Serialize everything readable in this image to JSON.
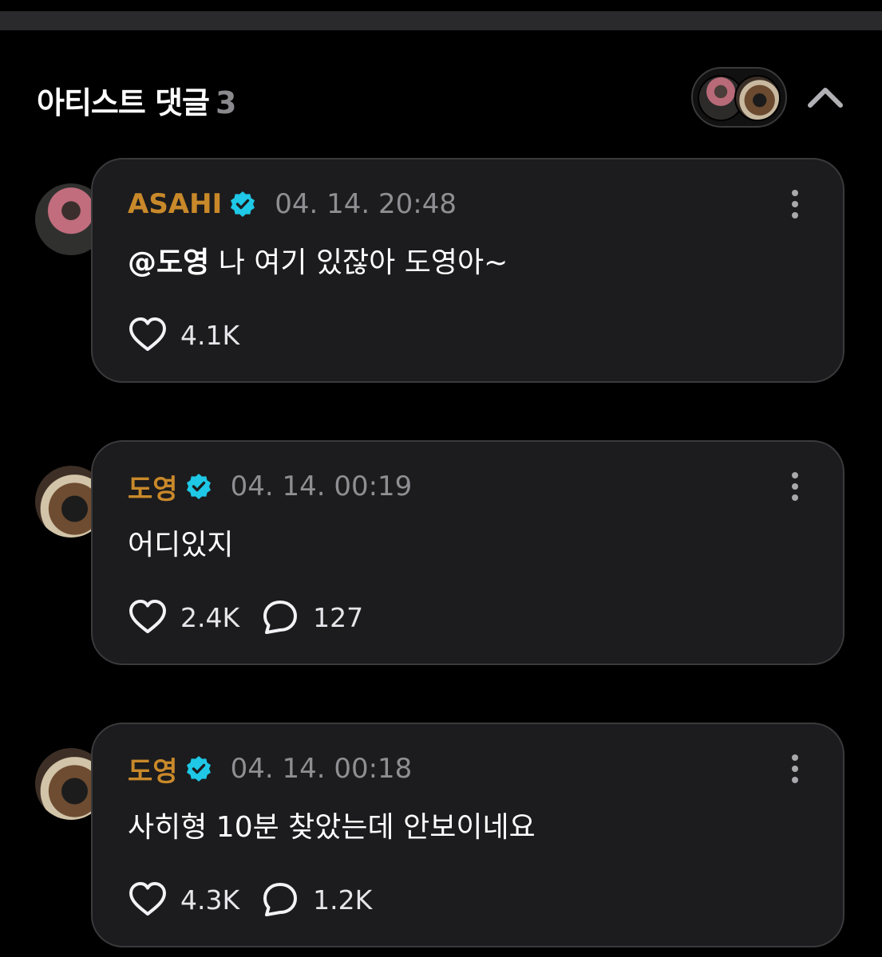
{
  "section": {
    "title": "아티스트 댓글",
    "count": "3"
  },
  "comments": [
    {
      "author": "ASAHI",
      "time": "04. 14. 20:48",
      "mention": "@도영",
      "text": " 나 여기 있잖아 도영아~",
      "likes": "4.1K",
      "replies": null
    },
    {
      "author": "도영",
      "time": "04. 14. 00:19",
      "mention": "",
      "text": "어디있지",
      "likes": "2.4K",
      "replies": "127"
    },
    {
      "author": "도영",
      "time": "04. 14. 00:18",
      "mention": "",
      "text": "사히형 10분 찾았는데 안보이네요",
      "likes": "4.3K",
      "replies": "1.2K"
    }
  ],
  "colors": {
    "background": "#000000",
    "card": "#1c1c1e",
    "author": "#c9892a",
    "verified": "#1ec8e6",
    "muted": "#8e8e93"
  },
  "icons": {
    "verified": "verified-badge-icon",
    "like": "heart-icon",
    "reply": "speech-bubble-icon",
    "more": "more-vertical-icon",
    "collapse": "chevron-up-icon"
  }
}
